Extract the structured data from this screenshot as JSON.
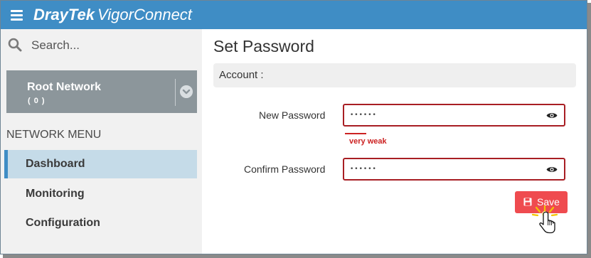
{
  "app": {
    "brand_bold": "DrayTek",
    "brand_rest": "VigorConnect",
    "header_color": "#3f8dc5"
  },
  "sidebar": {
    "search": {
      "placeholder": "Search..."
    },
    "root": {
      "name": "Root Network",
      "count": "( 0 )"
    },
    "menu_title": "NETWORK MENU",
    "items": [
      {
        "label": "Dashboard",
        "active": true
      },
      {
        "label": "Monitoring",
        "active": false
      },
      {
        "label": "Configuration",
        "active": false
      }
    ]
  },
  "main": {
    "title": "Set Password",
    "account_label": "Account :",
    "new_password": {
      "label": "New Password",
      "value": "••••••"
    },
    "strength": {
      "text": "very weak",
      "color": "#cc2222"
    },
    "confirm_password": {
      "label": "Confirm Password",
      "value": "••••••"
    },
    "save_label": "Save",
    "save_color": "#ef4b4f"
  },
  "icons": {
    "menu": "hamburger-icon",
    "search": "search-icon",
    "chevron": "chevron-down-icon",
    "eye": "eye-icon",
    "save": "floppy-disk-icon",
    "cursor": "hand-pointer-icon"
  }
}
